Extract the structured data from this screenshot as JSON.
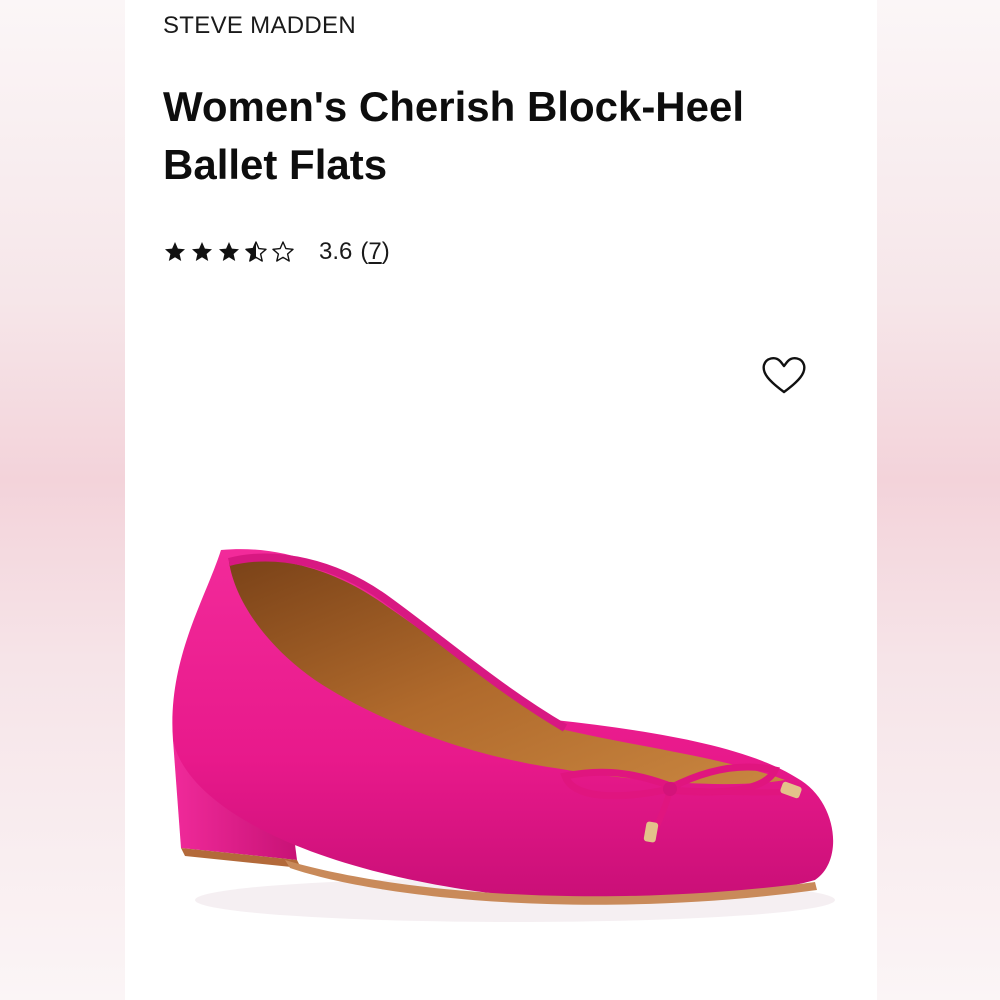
{
  "product": {
    "brand": "STEVE MADDEN",
    "title": "Women's Cherish Block-Heel Ballet Flats",
    "rating": {
      "stars_filled": 3.5,
      "stars_total": 5,
      "value": "3.6",
      "count": "7",
      "open_paren": "(",
      "close_paren": ")"
    },
    "image": {
      "description_icon": "ballet-flat-image",
      "color": "#e8198b"
    },
    "favorite_icon": "heart-outline-icon"
  }
}
